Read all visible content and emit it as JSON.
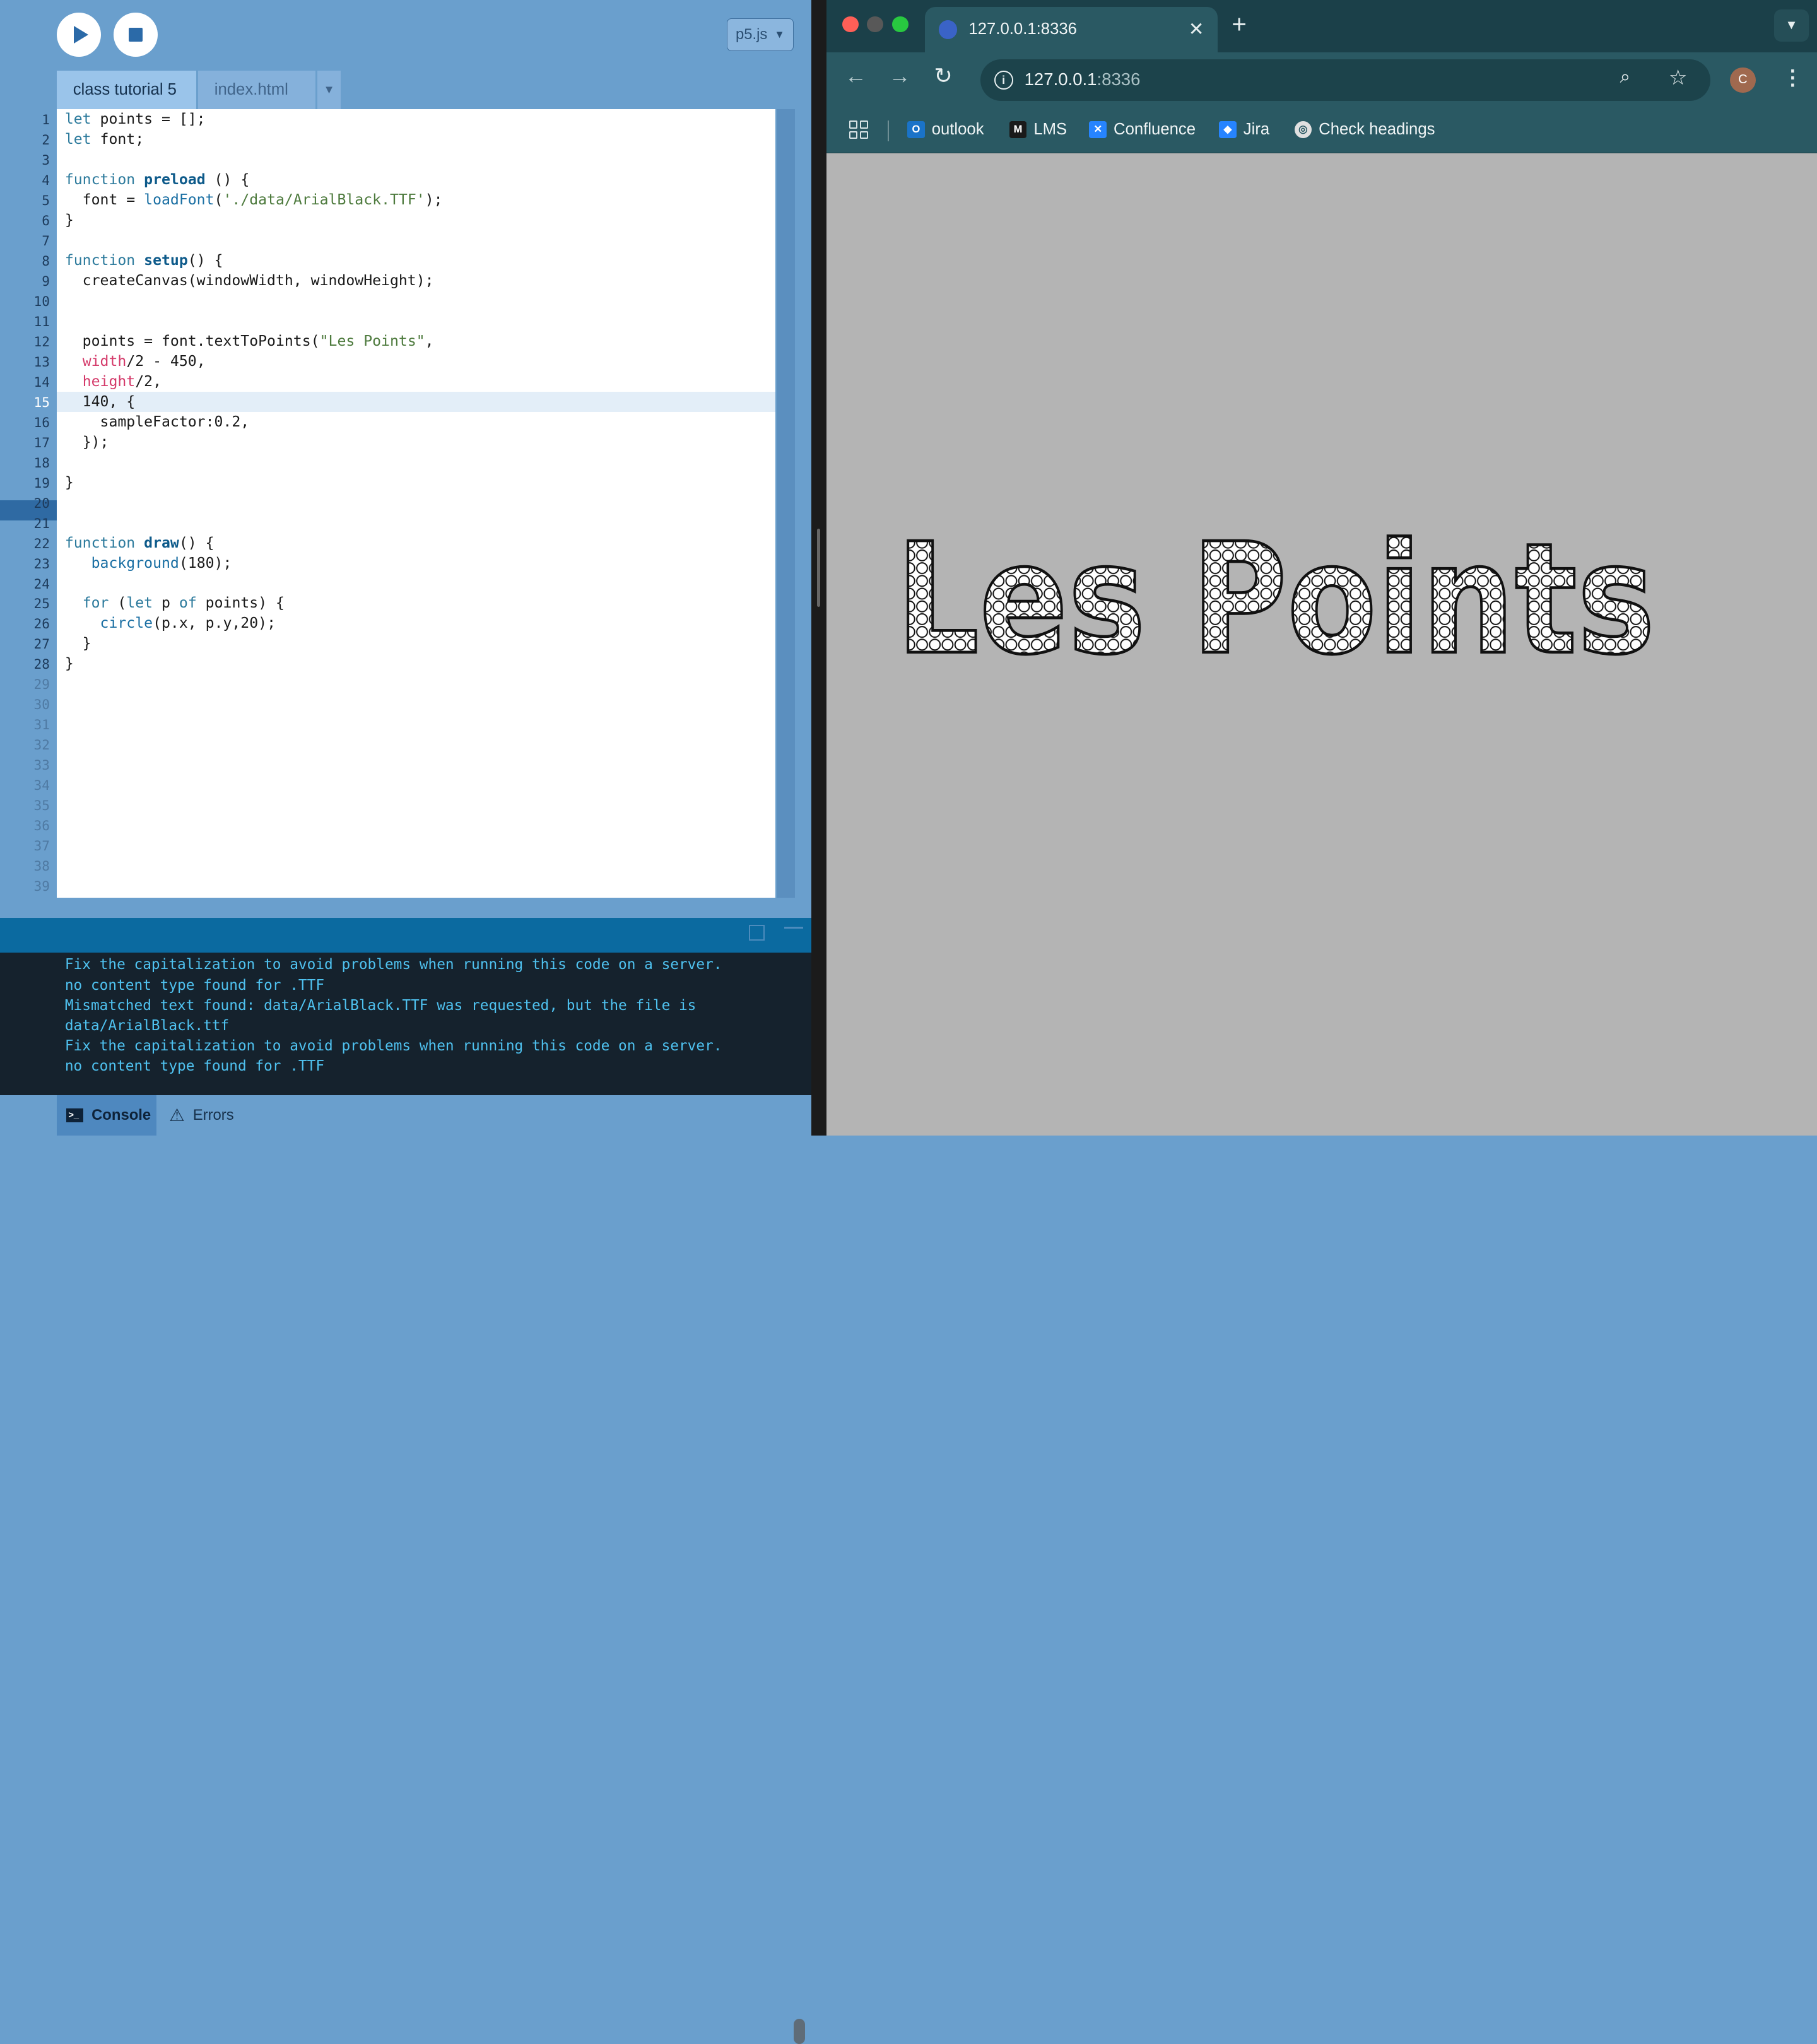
{
  "editor": {
    "play_label": "Play",
    "stop_label": "Stop",
    "mode": "p5.js",
    "tabs": [
      "class tutorial 5",
      "index.html"
    ],
    "line_numbers": [
      "1",
      "2",
      "3",
      "4",
      "5",
      "6",
      "7",
      "8",
      "9",
      "10",
      "11",
      "12",
      "13",
      "14",
      "15",
      "16",
      "17",
      "18",
      "19",
      "20",
      "21",
      "22",
      "23",
      "24",
      "25",
      "26",
      "27",
      "28",
      "29",
      "30",
      "31",
      "32",
      "33",
      "34",
      "35",
      "36",
      "37",
      "38",
      "39"
    ],
    "current_line": 15,
    "code_lines": [
      "let points = [];",
      "let font;",
      "",
      "function preload () {",
      "  font = loadFont('./data/ArialBlack.TTF');",
      "}",
      "",
      "function setup() {",
      "  createCanvas(windowWidth, windowHeight);",
      "",
      "",
      "  points = font.textToPoints(\"Les Points\",",
      "  width/2 - 450,",
      "  height/2,",
      "  140, {",
      "    sampleFactor:0.2,",
      "  });",
      "",
      "}",
      "",
      "",
      "function draw() {",
      "   background(180);",
      "",
      "  for (let p of points) {",
      "    circle(p.x, p.y,20);",
      "  }",
      "}"
    ]
  },
  "console": {
    "messages": [
      "Fix the capitalization to avoid problems when running this code on a server.",
      "no content type found for .TTF",
      "Mismatched text found: data/ArialBlack.TTF was requested, but the file is",
      "data/ArialBlack.ttf",
      "Fix the capitalization to avoid problems when running this code on a server.",
      "no content type found for .TTF"
    ],
    "tab_console": "Console",
    "tab_errors": "Errors"
  },
  "browser": {
    "tab_title": "127.0.0.1:8336",
    "url_host": "127.0.0.1",
    "url_port": ":8336",
    "profile_initial": "C",
    "bookmarks": [
      {
        "label": "outlook",
        "icon": "outlook-icon",
        "color": "#1a73c8"
      },
      {
        "label": "LMS",
        "icon": "lms-icon",
        "color": "#1a1a1a"
      },
      {
        "label": "Confluence",
        "icon": "confluence-icon",
        "color": "#2684ff"
      },
      {
        "label": "Jira",
        "icon": "jira-icon",
        "color": "#2684ff"
      },
      {
        "label": "Check headings",
        "icon": "globe-icon",
        "color": "#e0e0e0"
      }
    ]
  },
  "sketch_output": {
    "text": "Les Points",
    "background": "#b4b4b4"
  }
}
